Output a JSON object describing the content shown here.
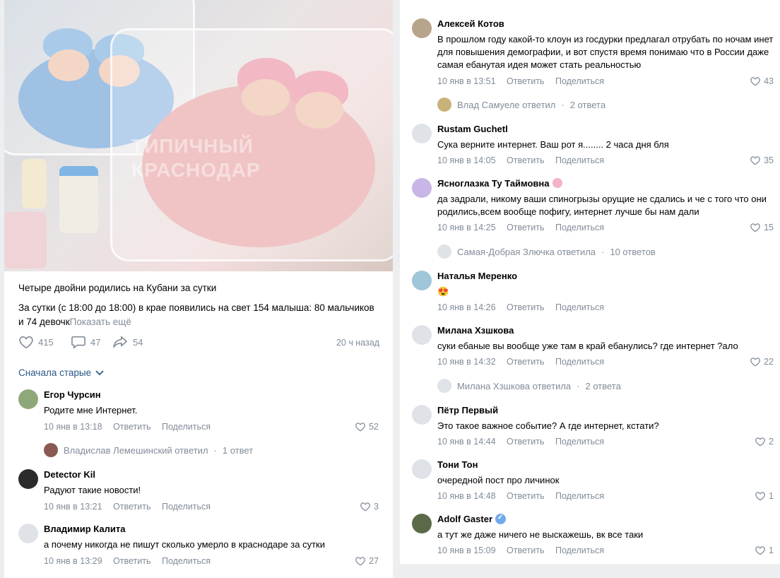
{
  "post": {
    "watermark": "ТИПИЧНЫЙ\nКРАСНОДАР",
    "title": "Четыре двойни родились на Кубани за сутки",
    "body": "За сутки (с 18:00 до 18:00) в крае появились на свет 154 малыша: 80 мальчиков и 74 девочк",
    "show_more": "Показать ещё",
    "likes": "415",
    "comments": "47",
    "shares": "54",
    "time_ago": "20 ч назад",
    "sort_label": "Сначала старые"
  },
  "actions": {
    "reply": "Ответить",
    "share": "Поделиться"
  },
  "left_comments": [
    {
      "name": "Егор Чурсин",
      "text": "Родите мне Интернет.",
      "date": "10 янв в 13:18",
      "likes": "52",
      "reply": {
        "who": "Владислав Лемешинский ответил",
        "count": "1 ответ"
      }
    },
    {
      "name": "Detector Kil",
      "text": "Радуют такие новости!",
      "date": "10 янв в 13:21",
      "likes": "3"
    },
    {
      "name": "Владимир Калита",
      "text": "а почему никогда не пишут сколько умерло в краснодаре за сутки",
      "date": "10 янв в 13:29",
      "likes": "27"
    }
  ],
  "right_comments": [
    {
      "name": "Алексей Котов",
      "text": "В прошлом году какой-то клоун из госдурки предлагал отрубать по ночам инет для повышения демографии, и вот спустя время понимаю что в России даже самая ебанутая идея может стать реальностью",
      "date": "10 янв в 13:51",
      "likes": "43",
      "reply": {
        "who": "Влад Самуеле ответил",
        "count": "2 ответа"
      }
    },
    {
      "name": "Rustam Guchetl",
      "text": "Сука верните интернет. Ваш рот я........ 2 часа дня бля",
      "date": "10 янв в 14:05",
      "likes": "35"
    },
    {
      "name": "Ясноглазка Ту Таймовна",
      "text": "да задрали, никому ваши спиногрызы орущие не сдались и че с того что они родились,всем вообще пофигу, интернет лучше бы нам дали",
      "date": "10 янв в 14:25",
      "likes": "15",
      "reply": {
        "who": "Самая-Добрая Злючка ответила",
        "count": "10 ответов"
      }
    },
    {
      "name": "Наталья Меренко",
      "text": "😍",
      "date": "10 янв в 14:26",
      "likes": ""
    },
    {
      "name": "Милана Хзшкова",
      "text": "суки ебаные вы вообще уже там в край ебанулись? где интернет ?ало",
      "date": "10 янв в 14:32",
      "likes": "22",
      "reply": {
        "who": "Милана Хзшкова ответила",
        "count": "2 ответа"
      }
    },
    {
      "name": "Пётр Первый",
      "text": "Это такое важное событие? А где интернет, кстати?",
      "date": "10 янв в 14:44",
      "likes": "2"
    },
    {
      "name": "Тони Тон",
      "text": "очередной пост про личинок",
      "date": "10 янв в 14:48",
      "likes": "1"
    },
    {
      "name": "Adolf Gaster",
      "text": "а тут же даже ничего не выскажешь, вк все таки",
      "date": "10 янв в 15:09",
      "likes": "1"
    }
  ],
  "colors": {
    "link": "#2a5885",
    "meta": "#818c99",
    "bg": "#edeef0",
    "verified": "#71aaeb"
  }
}
